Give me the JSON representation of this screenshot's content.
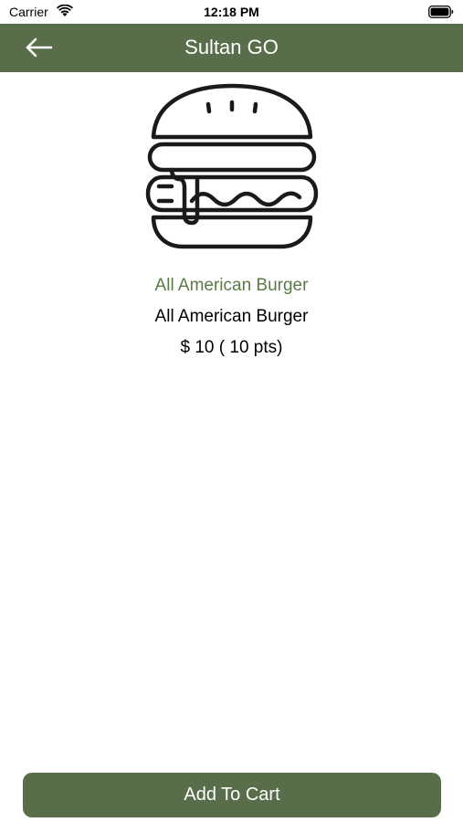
{
  "status_bar": {
    "carrier": "Carrier",
    "time": "12:18 PM"
  },
  "nav": {
    "title": "Sultan GO",
    "back_icon": "arrow-left-icon"
  },
  "product": {
    "image_icon": "burger-icon",
    "category": "All American Burger",
    "name": "All American Burger",
    "price": "$ 10 ( 10 pts)"
  },
  "actions": {
    "add_to_cart_label": "Add To Cart"
  },
  "colors": {
    "primary": "#586e4a",
    "category_text": "#5a7a48",
    "background": "#ffffff"
  }
}
